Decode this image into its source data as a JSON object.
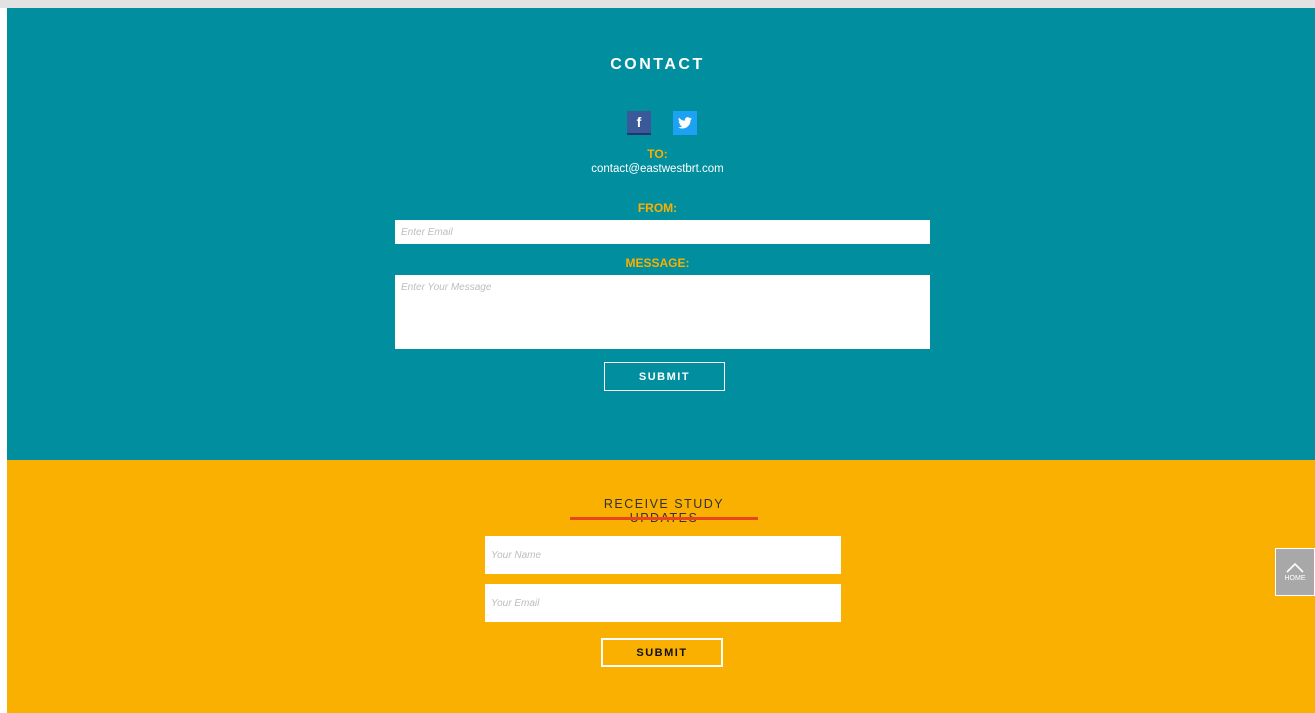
{
  "contact": {
    "title": "CONTACT",
    "social": [
      {
        "name": "facebook",
        "glyph": "f",
        "color": "#3b5998"
      },
      {
        "name": "twitter",
        "color": "#1da1f2"
      }
    ],
    "to_label": "TO:",
    "to_email": "contact@eastwestbrt.com",
    "from_label": "FROM:",
    "from_placeholder": "Enter Email",
    "message_label": "MESSAGE:",
    "message_placeholder": "Enter Your Message",
    "submit_label": "SUBMIT",
    "background": "#018e9f",
    "accent": "#f9b000"
  },
  "updates": {
    "title": "RECEIVE STUDY UPDATES",
    "name_placeholder": "Your Name",
    "email_placeholder": "Your Email",
    "submit_label": "SUBMIT",
    "background": "#f9b000",
    "underline_color": "#e8461e"
  },
  "home_button": {
    "label": "HOME",
    "icon": "chevron-up-icon"
  }
}
